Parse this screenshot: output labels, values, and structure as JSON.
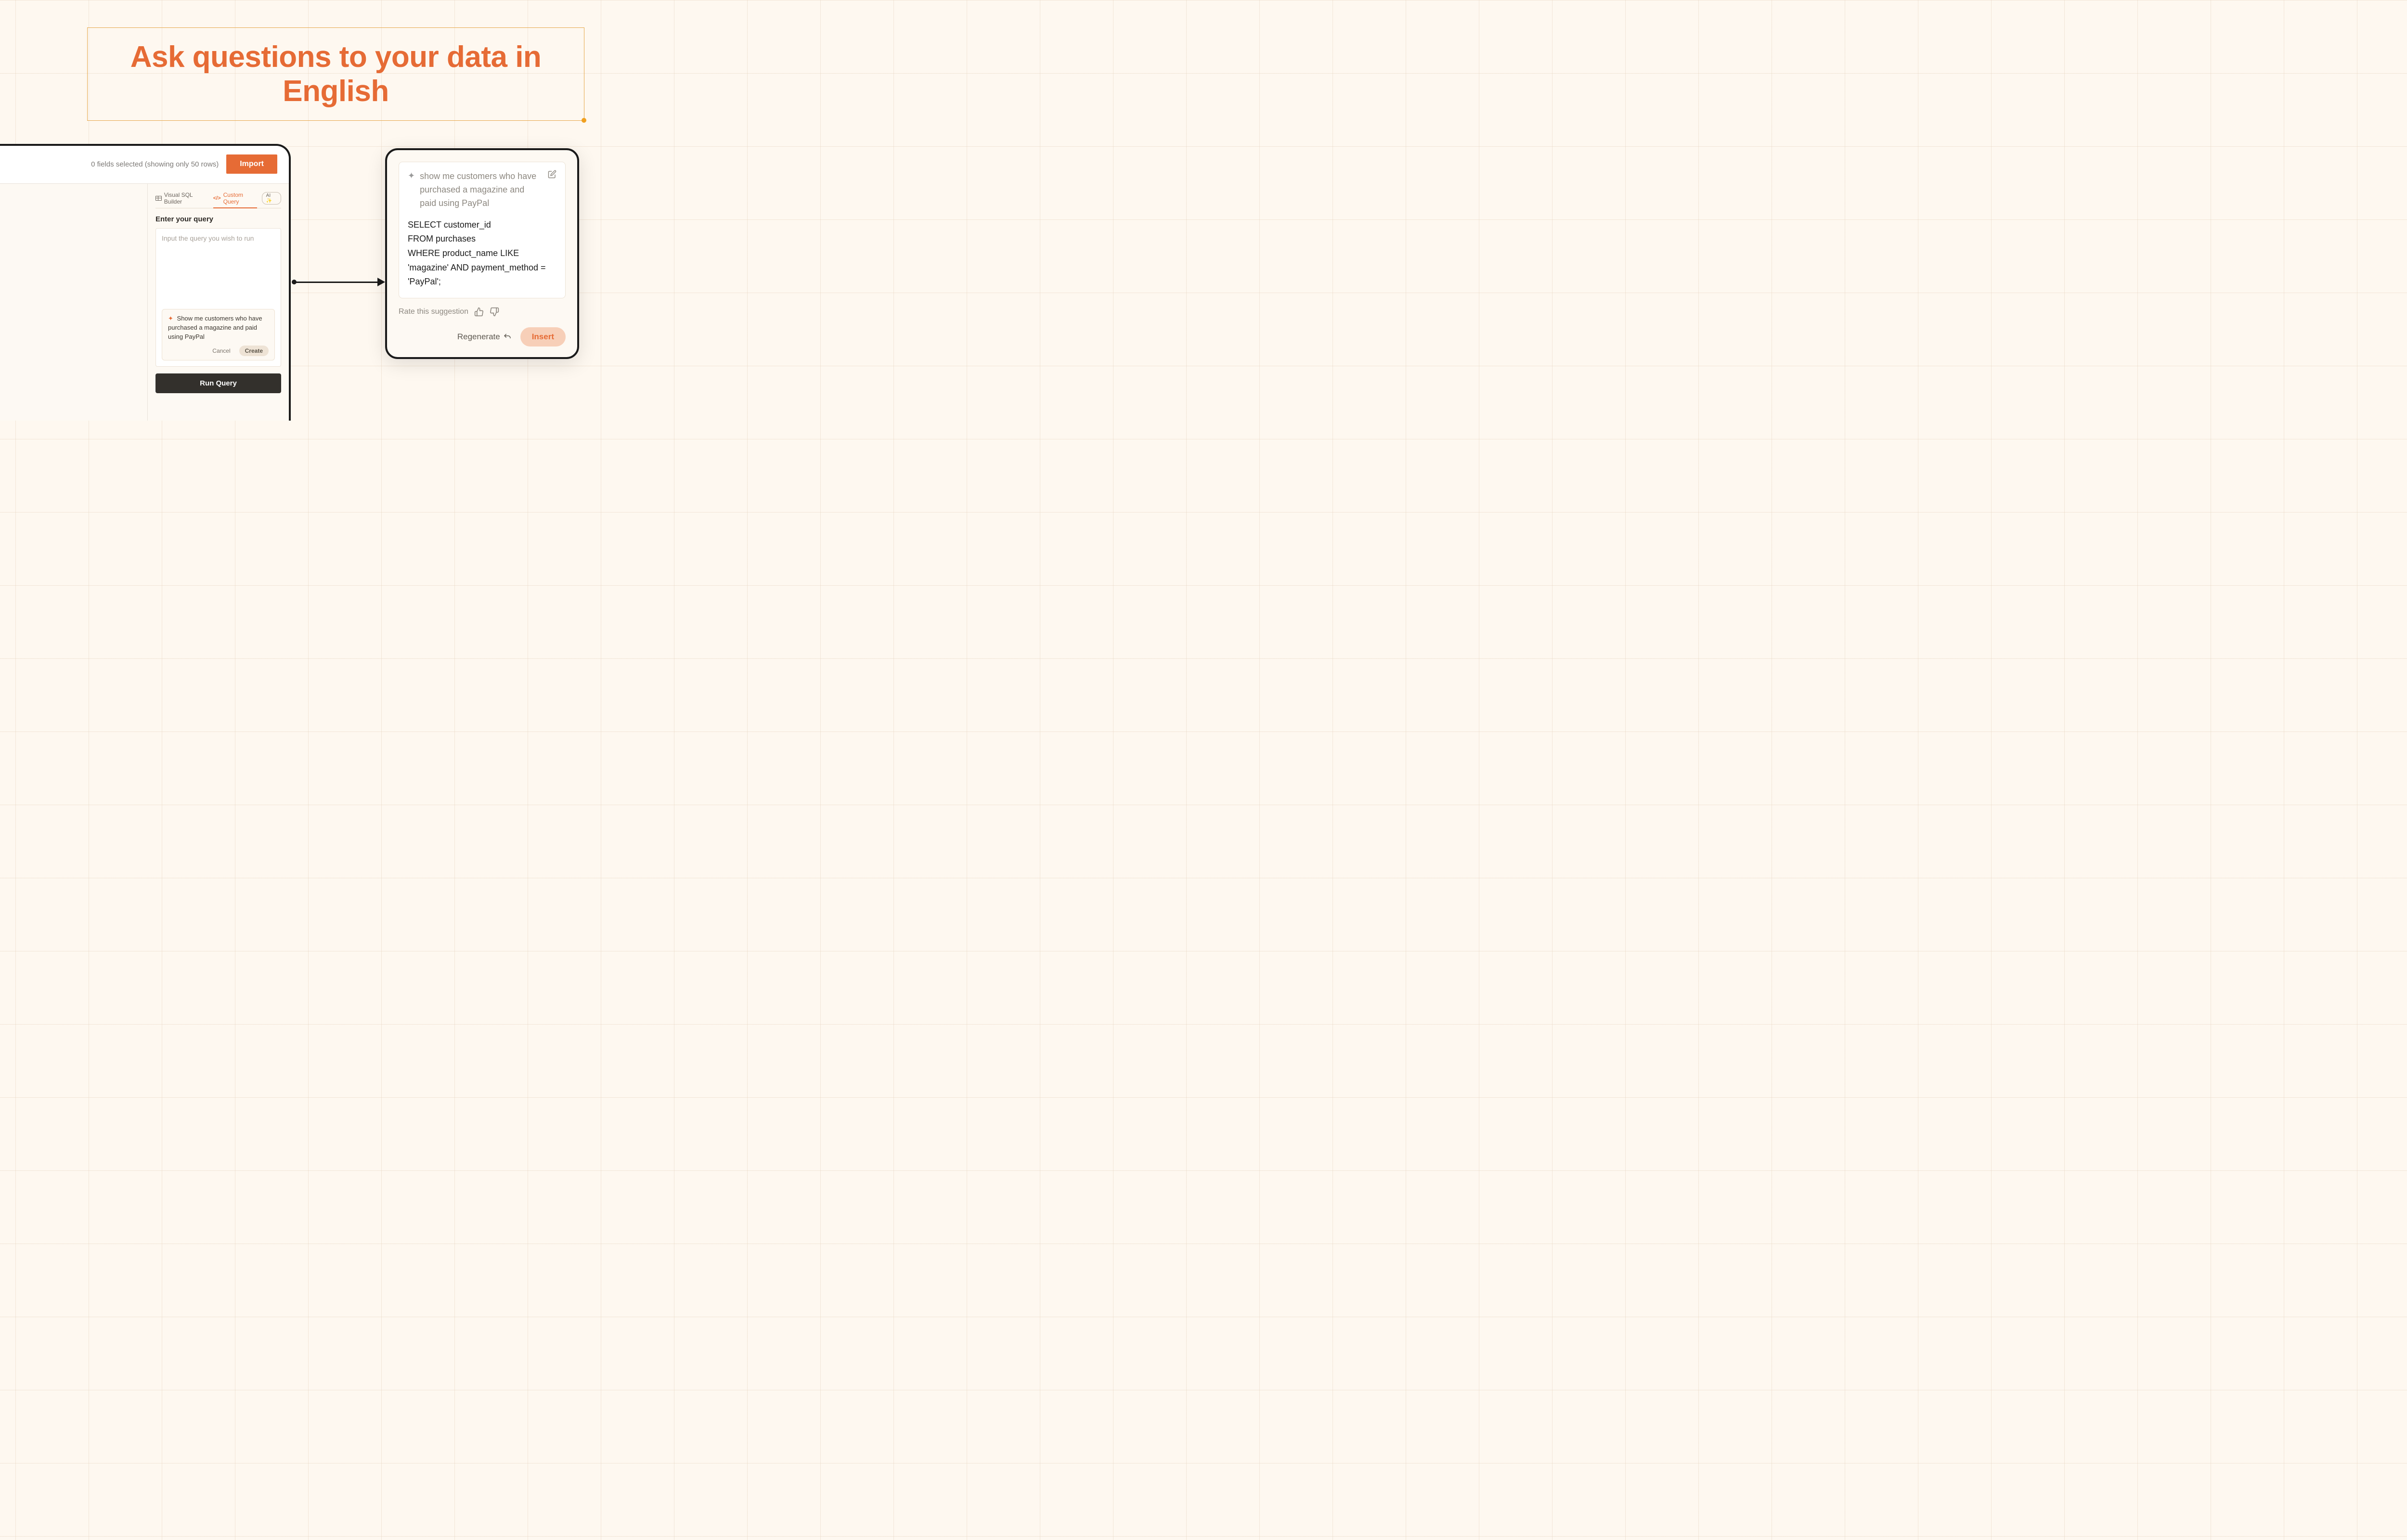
{
  "banner": {
    "headline": "Ask questions to your data in English"
  },
  "query_panel": {
    "status_text": "0 fields selected (showing only 50 rows)",
    "import_label": "Import",
    "tabs": {
      "visual": "Visual SQL Builder",
      "custom": "Custom Query",
      "ai": "AI ✨"
    },
    "section_heading": "Enter your query",
    "input_placeholder": "Input the query you wish to run",
    "suggestion_text": "Show me customers who have purchased a magazine and paid using PayPal",
    "cancel_label": "Cancel",
    "create_label": "Create",
    "run_label": "Run Query"
  },
  "result_card": {
    "prompt": "show me customers who have purchased a magazine and paid using PayPal",
    "sql": "SELECT customer_id\nFROM purchases\nWHERE product_name LIKE 'magazine' AND payment_method = 'PayPal';",
    "rate_label": "Rate this suggestion",
    "regenerate_label": "Regenerate",
    "insert_label": "Insert"
  }
}
